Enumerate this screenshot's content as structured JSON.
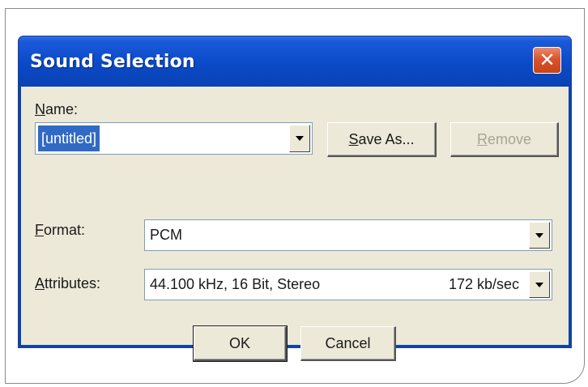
{
  "dialog": {
    "title": "Sound Selection",
    "close_symbol": "✕"
  },
  "name": {
    "label_accel": "N",
    "label_rest": "ame:",
    "value": "[untitled]"
  },
  "buttons": {
    "save_as_accel": "S",
    "save_as_rest": "ave As...",
    "remove_accel": "R",
    "remove_rest": "emove",
    "ok": "OK",
    "cancel": "Cancel"
  },
  "format": {
    "label_accel": "F",
    "label_rest": "ormat:",
    "value": "PCM"
  },
  "attributes": {
    "label_accel": "A",
    "label_rest": "ttributes:",
    "value": "44.100 kHz, 16 Bit, Stereo",
    "rate": "172 kb/sec"
  },
  "colors": {
    "titlebar": "#0a49c7",
    "close_button": "#d9532c",
    "client": "#ece9d8",
    "selection": "#316ac5"
  },
  "icons": {
    "close": "close-icon",
    "dropdown": "chevron-down-icon"
  }
}
